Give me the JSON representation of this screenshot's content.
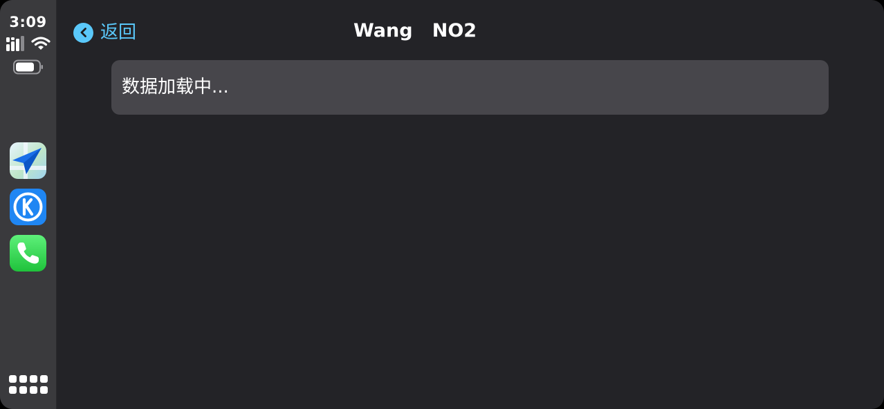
{
  "status": {
    "time": "3:09",
    "signal_icon": "cellular-signal-icon",
    "wifi_icon": "wifi-icon",
    "battery_icon": "battery-icon"
  },
  "dock": {
    "apps": [
      {
        "name": "navigation-app",
        "icon": "paper-plane-icon"
      },
      {
        "name": "kugou-music-app",
        "icon": "k-logo-icon"
      },
      {
        "name": "phone-app",
        "icon": "phone-icon"
      }
    ],
    "home_icon": "app-grid-icon"
  },
  "header": {
    "back_label": "返回",
    "title": "Wang   NO2"
  },
  "list": {
    "loading_text": "数据加载中..."
  },
  "colors": {
    "accent": "#5ac8fa",
    "background": "#232327",
    "sidebar": "#3a3a3d",
    "row": "#47464b"
  }
}
